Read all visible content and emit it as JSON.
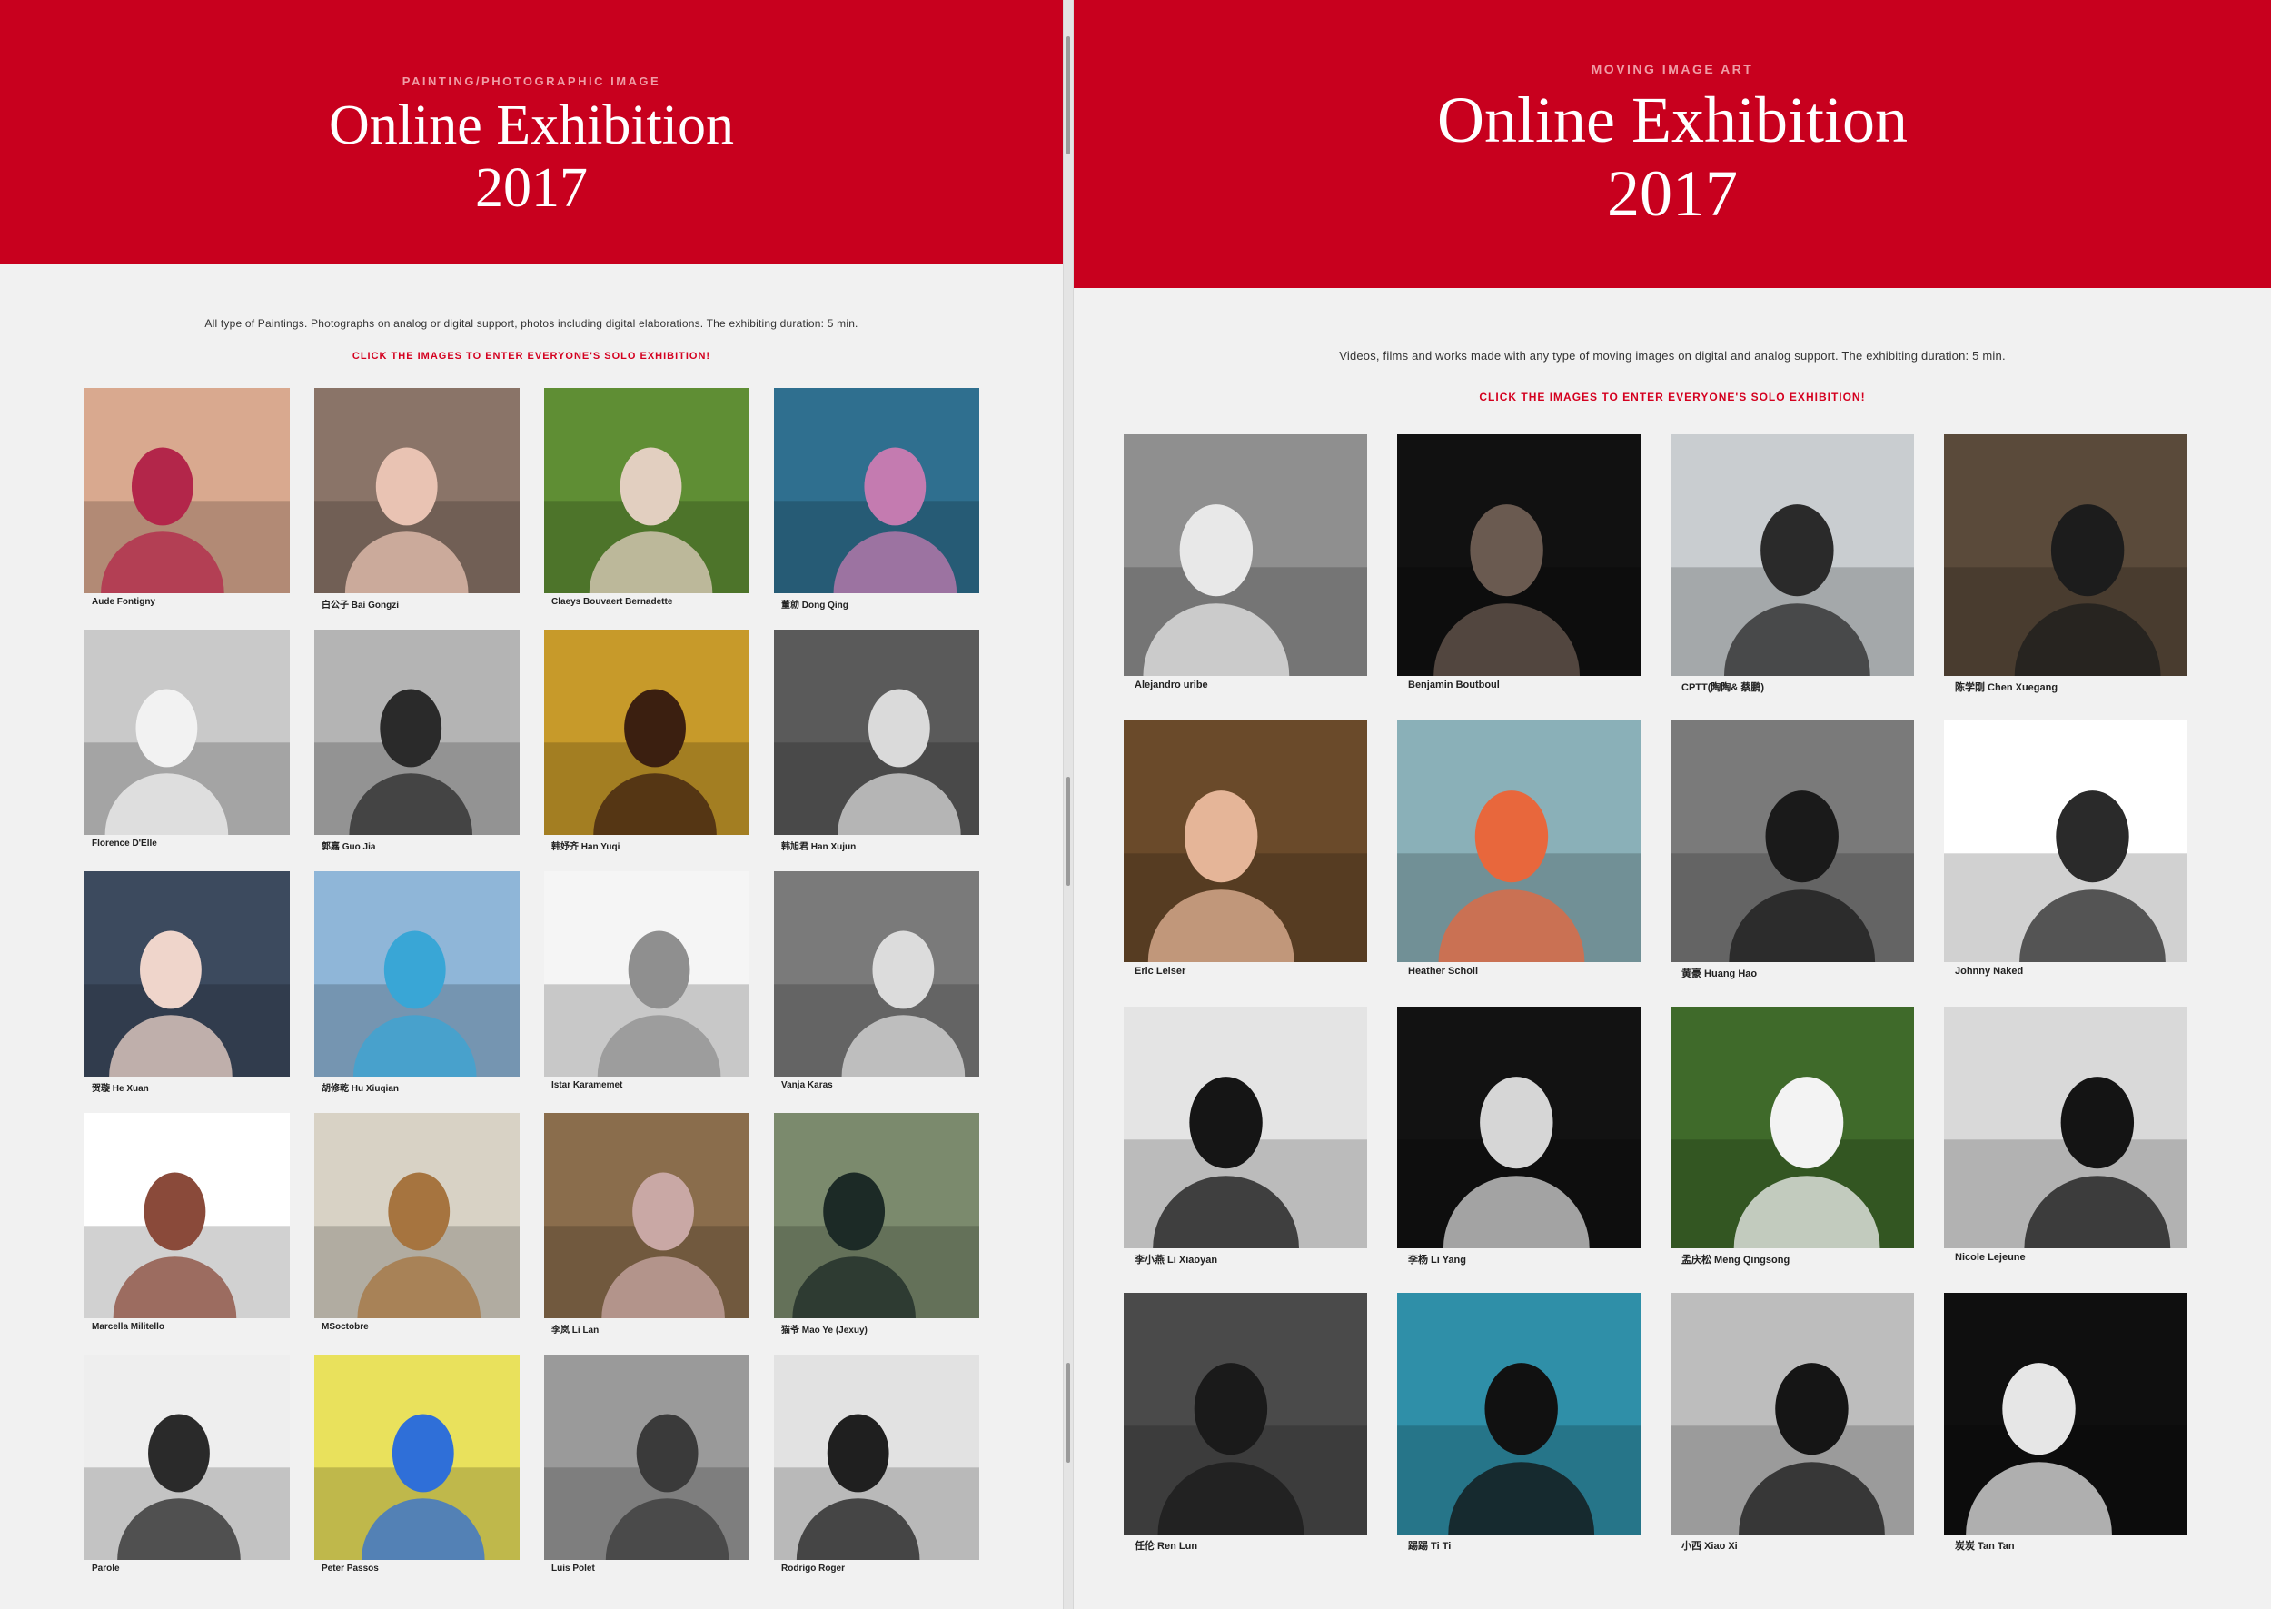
{
  "left": {
    "kicker": "PAINTING/PHOTOGRAPHIC IMAGE",
    "title_line1": "Online Exhibition",
    "title_line2": "2017",
    "description": "All type of Paintings. Photographs on analog or digital support, photos including digital elaborations. The exhibiting duration: 5 min.",
    "cta": "CLICK THE IMAGES TO ENTER EVERYONE'S SOLO EXHIBITION!",
    "artists": [
      {
        "name": "Aude Fontigny",
        "bg": "#d9a98f",
        "fg": "#b3264a",
        "bw": false
      },
      {
        "name": "白公子 Bai Gongzi",
        "bg": "#8a7468",
        "fg": "#e9c3b3",
        "bw": false
      },
      {
        "name": "Claeys Bouvaert Bernadette",
        "bg": "#5f8e34",
        "fg": "#e2cfc0",
        "bw": false
      },
      {
        "name": "董勍 Dong Qing",
        "bg": "#2f6f8f",
        "fg": "#c47bb0",
        "bw": false
      },
      {
        "name": "Florence D'Elle",
        "bg": "#c9c9c9",
        "fg": "#f2f2f2",
        "bw": true
      },
      {
        "name": "郭嘉 Guo Jia",
        "bg": "#b4b4b4",
        "fg": "#2a2a2a",
        "bw": true
      },
      {
        "name": "韩妤齐 Han Yuqi",
        "bg": "#c79a2a",
        "fg": "#3b1f10",
        "bw": false
      },
      {
        "name": "韩旭君 Han Xujun",
        "bg": "#5a5a5a",
        "fg": "#dadada",
        "bw": true
      },
      {
        "name": "贺璇 He Xuan",
        "bg": "#3c4a5e",
        "fg": "#efd5cb",
        "bw": false
      },
      {
        "name": "胡修乾 Hu Xiuqian",
        "bg": "#8fb6d8",
        "fg": "#39a6d6",
        "bw": false
      },
      {
        "name": "Istar Karamemet",
        "bg": "#f5f5f5",
        "fg": "#8f8f8f",
        "bw": true
      },
      {
        "name": "Vanja Karas",
        "bg": "#7a7a7a",
        "fg": "#dcdcdc",
        "bw": true
      },
      {
        "name": "Marcella Militello",
        "bg": "#ffffff",
        "fg": "#8a4a3a",
        "bw": false
      },
      {
        "name": "MSoctobre",
        "bg": "#d8d2c5",
        "fg": "#a6743f",
        "bw": false
      },
      {
        "name": "李岚 Li Lan",
        "bg": "#8a6d4c",
        "fg": "#c9a8a5",
        "bw": false
      },
      {
        "name": "猫爷 Mao Ye (Jexuy)",
        "bg": "#7b8a6d",
        "fg": "#1c2a26",
        "bw": false
      },
      {
        "name": "Parole",
        "bg": "#eeeeee",
        "fg": "#2a2a2a",
        "bw": false
      },
      {
        "name": "Peter Passos",
        "bg": "#e9e15c",
        "fg": "#2f6fd8",
        "bw": false
      },
      {
        "name": "Luis Polet",
        "bg": "#9a9a9a",
        "fg": "#3a3a3a",
        "bw": true
      },
      {
        "name": "Rodrigo Roger",
        "bg": "#e2e2e2",
        "fg": "#1f1f1f",
        "bw": true
      }
    ]
  },
  "right": {
    "kicker": "MOVING IMAGE ART",
    "title_line1": "Online Exhibition",
    "title_line2": "2017",
    "description": "Videos, films and works made with any type of moving images on digital and analog support. The exhibiting duration: 5 min.",
    "cta": "CLICK THE IMAGES TO ENTER EVERYONE'S SOLO EXHIBITION!",
    "artists": [
      {
        "name": "Alejandro uribe",
        "bg": "#8f8f8f",
        "fg": "#e8e8e8",
        "bw": true
      },
      {
        "name": "Benjamin Boutboul",
        "bg": "#111111",
        "fg": "#6a5a50",
        "bw": false
      },
      {
        "name": "CPTT(陶陶& 蔡鹏)",
        "bg": "#c9cdd0",
        "fg": "#2a2a2a",
        "bw": false
      },
      {
        "name": "陈学刚 Chen Xuegang",
        "bg": "#5a4a3a",
        "fg": "#1c1c1c",
        "bw": false
      },
      {
        "name": "Eric Leiser",
        "bg": "#6a4a2a",
        "fg": "#e5b598",
        "bw": false
      },
      {
        "name": "Heather Scholl",
        "bg": "#8ab0b8",
        "fg": "#e8673c",
        "bw": false
      },
      {
        "name": "黄豪 Huang Hao",
        "bg": "#7a7a7a",
        "fg": "#1a1a1a",
        "bw": true
      },
      {
        "name": "Johnny Naked",
        "bg": "#ffffff",
        "fg": "#2a2a2a",
        "bw": true
      },
      {
        "name": "李小燕 Li Xiaoyan",
        "bg": "#e4e4e4",
        "fg": "#151515",
        "bw": true
      },
      {
        "name": "李杨 Li Yang",
        "bg": "#121212",
        "fg": "#d6d6d6",
        "bw": true
      },
      {
        "name": "孟庆松 Meng Qingsong",
        "bg": "#3f6a2a",
        "fg": "#f3f3f3",
        "bw": false
      },
      {
        "name": "Nicole Lejeune",
        "bg": "#d9d9d9",
        "fg": "#141414",
        "bw": false
      },
      {
        "name": "任伦 Ren Lun",
        "bg": "#4a4a4a",
        "fg": "#1a1a1a",
        "bw": true
      },
      {
        "name": "踢踢 Ti Ti",
        "bg": "#2f8fa8",
        "fg": "#111111",
        "bw": false
      },
      {
        "name": "小西 Xiao Xi",
        "bg": "#bdbdbd",
        "fg": "#151515",
        "bw": true
      },
      {
        "name": "炭炭 Tan Tan",
        "bg": "#0f0f0f",
        "fg": "#e6e6e6",
        "bw": true
      }
    ]
  }
}
